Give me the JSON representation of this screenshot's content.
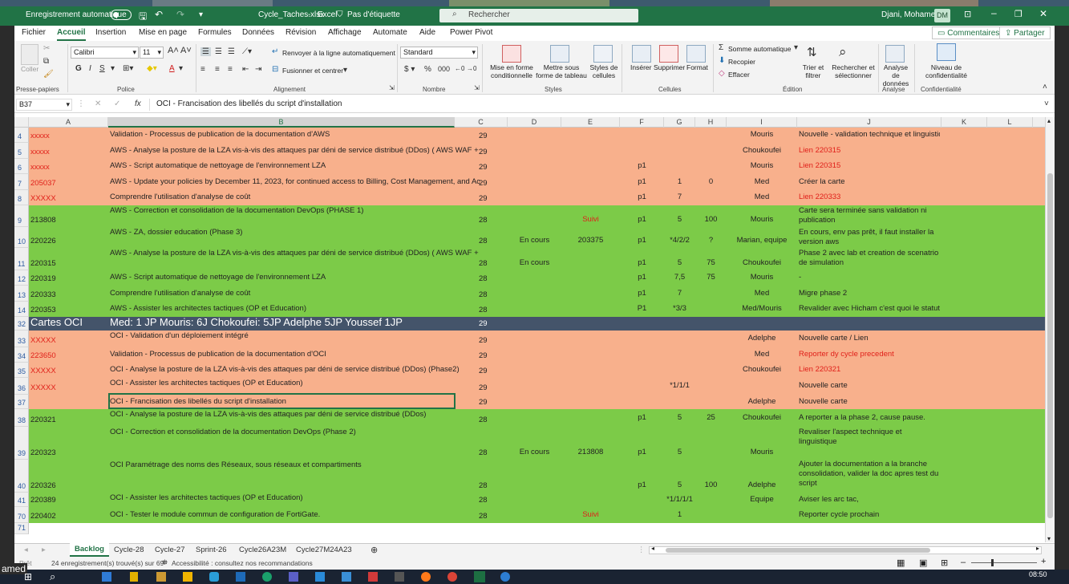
{
  "titlebar": {
    "autosave": "Enregistrement automatique",
    "filename": "Cycle_Taches.xlsx",
    "app": "Excel",
    "label": "Pas d'étiquette",
    "search": "Rechercher",
    "user": "Djani, Mohamed",
    "initials": "DM"
  },
  "menu": {
    "tabs": [
      "Fichier",
      "Accueil",
      "Insertion",
      "Mise en page",
      "Formules",
      "Données",
      "Révision",
      "Affichage",
      "Automate",
      "Aide",
      "Power Pivot"
    ],
    "comments": "Commentaires",
    "share": "Partager"
  },
  "ribbon": {
    "paste": "Coller",
    "font_name": "Calibri",
    "font_size": "11",
    "wrap": "Renvoyer à la ligne automatiquement",
    "merge": "Fusionner et centrer",
    "number_format": "Standard",
    "cond_format": "Mise en forme conditionnelle",
    "format_table": "Mettre sous forme de tableau",
    "cell_styles": "Styles de cellules",
    "insert": "Insérer",
    "delete": "Supprimer",
    "format": "Format",
    "autosum": "Somme automatique",
    "fill": "Recopier",
    "clear": "Effacer",
    "sort": "Trier et filtrer",
    "find": "Rechercher et sélectionner",
    "analyze": "Analyse de données",
    "sensitivity": "Niveau de confidentialité",
    "groups": {
      "clipboard": "Presse-papiers",
      "font": "Police",
      "alignment": "Alignement",
      "number": "Nombre",
      "styles": "Styles",
      "cells": "Cellules",
      "editing": "Édition",
      "analysis": "Analyse",
      "confidentiality": "Confidentialité"
    }
  },
  "formula": {
    "namebox": "B37",
    "content": "OCI - Francisation des libellés du script d'installation"
  },
  "columns": [
    "A",
    "B",
    "C",
    "D",
    "E",
    "F",
    "G",
    "H",
    "I",
    "J",
    "K",
    "L"
  ],
  "rows": [
    {
      "n": "4",
      "A": "xxxxx",
      "B": "Validation - Processus de publication de la documentation d'AWS",
      "C": "29",
      "D": "",
      "E": "",
      "F": "",
      "G": "",
      "H": "",
      "I": "Mouris",
      "J": "Nouvelle - validation technique et linguistique"
    },
    {
      "n": "5",
      "A": "xxxxx",
      "B": "AWS - Analyse la posture de la LZA vis-à-vis des attaques par déni de service distribué (DDos)  ( AWS WAF +",
      "C": "29",
      "D": "",
      "E": "",
      "F": "",
      "G": "",
      "H": "",
      "I": "Choukoufei",
      "J": "Lien 220315"
    },
    {
      "n": "6",
      "A": "xxxxx",
      "B": "AWS - Script automatique de nettoyage de l'environnement LZA",
      "C": "29",
      "D": "",
      "E": "",
      "F": "p1",
      "G": "",
      "H": "",
      "I": "Mouris",
      "J": "Lien 220315"
    },
    {
      "n": "7",
      "A": "205037",
      "B": "AWS - Update your policies by December 11, 2023, for continued access to Billing, Cost Management, and Ac",
      "C": "29",
      "D": "",
      "E": "",
      "F": "p1",
      "G": "1",
      "H": "0",
      "I": "Med",
      "J": "Créer la carte"
    },
    {
      "n": "8",
      "A": "XXXXX",
      "B": "Comprendre l'utilisation d'analyse de coût",
      "C": "29",
      "D": "",
      "E": "",
      "F": "p1",
      "G": "7",
      "H": "",
      "I": "Med",
      "J": "Lien 220333"
    },
    {
      "n": "9",
      "A": "213808",
      "B": "AWS - Correction et consolidation de la documentation DevOps (PHASE 1)",
      "C": "28",
      "D": "",
      "E": "Suivi",
      "F": "p1",
      "G": "5",
      "H": "100",
      "I": "Mouris",
      "J": "Carte sera terminée sans validation ni publication"
    },
    {
      "n": "10",
      "A": "220226",
      "B": "AWS - ZA, dossier education (Phase 3)",
      "C": "28",
      "D": "En cours",
      "E": "203375",
      "F": "p1",
      "G": "*4/2/2",
      "H": "?",
      "I": "Marian, equipe",
      "J": "En cours,  env pas prêt, il faut installer la version aws"
    },
    {
      "n": "11",
      "A": "220315",
      "B": "AWS - Analyse la posture de la LZA vis-à-vis des attaques par déni de service distribué (DDos)  ( AWS WAF +",
      "C": "28",
      "D": "En cours",
      "E": "",
      "F": "p1",
      "G": "5",
      "H": "75",
      "I": "Choukoufei",
      "J": "Phase 2 avec lab et creation de scenatrio de simulation"
    },
    {
      "n": "12",
      "A": "220319",
      "B": "AWS - Script automatique de nettoyage de l'environnement LZA",
      "C": "28",
      "D": "",
      "E": "",
      "F": "p1",
      "G": "7,5",
      "H": "75",
      "I": "Mouris",
      "J": "-"
    },
    {
      "n": "13",
      "A": "220333",
      "B": "Comprendre l'utilisation d'analyse de coût",
      "C": "28",
      "D": "",
      "E": "",
      "F": "p1",
      "G": "7",
      "H": "",
      "I": "Med",
      "J": "Migre phase 2"
    },
    {
      "n": "14",
      "A": "220353",
      "B": "AWS - Assister les architectes tactiques (OP et Education)",
      "C": "28",
      "D": "",
      "E": "",
      "F": "P1",
      "G": "*3/3",
      "H": "",
      "I": "Med/Mouris",
      "J": "Revalider avec Hicham c'est quoi le statut"
    },
    {
      "n": "32",
      "A": "Cartes OCI",
      "B": "Med:  1 JP  Mouris: 6J  Chokoufei: 5JP Adelphe  5JP Youssef 1JP",
      "C": "29",
      "D": "",
      "E": "",
      "F": "",
      "G": "",
      "H": "",
      "I": "",
      "J": ""
    },
    {
      "n": "33",
      "A": "XXXXX",
      "B": "OCI - Validation d'un déploiement intégré",
      "C": "29",
      "D": "",
      "E": "",
      "F": "",
      "G": "",
      "H": "",
      "I": "Adelphe",
      "J": "Nouvelle carte / Lien"
    },
    {
      "n": "34",
      "A": "223650",
      "B": "Validation - Processus de publication de la documentation d'OCI",
      "C": "29",
      "D": "",
      "E": "",
      "F": "",
      "G": "",
      "H": "",
      "I": "Med",
      "J": "Reporter dy cycle precedent"
    },
    {
      "n": "35",
      "A": "XXXXX",
      "B": "OCI - Analyse la posture de la LZA vis-à-vis des attaques par déni de service distribué (DDos)  (Phase2)",
      "C": "29",
      "D": "",
      "E": "",
      "F": "",
      "G": "",
      "H": "",
      "I": "Choukoufei",
      "J": "Lien 220321"
    },
    {
      "n": "36",
      "A": "XXXXX",
      "B": "OCI  - Assister les architectes tactiques (OP et Education)",
      "C": "29",
      "D": "",
      "E": "",
      "F": "",
      "G": "*1/1/1",
      "H": "",
      "I": "",
      "J": "Nouvelle carte"
    },
    {
      "n": "37",
      "A": "",
      "B": "OCI - Francisation des libellés du script d'installation",
      "C": "29",
      "D": "",
      "E": "",
      "F": "",
      "G": "",
      "H": "",
      "I": "Adelphe",
      "J": "Nouvelle carte"
    },
    {
      "n": "38",
      "A": "220321",
      "B": "OCI - Analyse la posture de la LZA vis-à-vis des attaques par déni de service distribué (DDos)",
      "C": "28",
      "D": "",
      "E": "",
      "F": "p1",
      "G": "5",
      "H": "25",
      "I": "Choukoufei",
      "J": "A reporter a la phase 2, cause pause."
    },
    {
      "n": "39",
      "A": "220323",
      "B": "OCI - Correction et consolidation de la documentation DevOps  (Phase 2)",
      "C": "28",
      "D": "En cours",
      "E": "213808",
      "F": "p1",
      "G": "5",
      "H": "",
      "I": "Mouris",
      "J": "Revaliser l'aspect technique et linguistique"
    },
    {
      "n": "40",
      "A": "220326",
      "B": "OCI Paramétrage des noms des Réseaux, sous réseaux et compartiments",
      "C": "28",
      "D": "",
      "E": "",
      "F": "p1",
      "G": "5",
      "H": "100",
      "I": "Adelphe",
      "J": "Ajouter la documentation a la branche consolidation, valider la doc apres test du script"
    },
    {
      "n": "41",
      "A": "220389",
      "B": "OCI  - Assister les architectes tactiques (OP et Education)",
      "C": "28",
      "D": "",
      "E": "",
      "F": "",
      "G": "*1/1/1/1",
      "H": "",
      "I": "Equipe",
      "J": "Aviser les arc tac,"
    },
    {
      "n": "70",
      "A": "220402",
      "B": "OCI - Tester le module commun de configuration  de FortiGate.",
      "C": "28",
      "D": "",
      "E": "Suivi",
      "F": "",
      "G": "1",
      "H": "",
      "I": "",
      "J": "Reporter cycle prochain"
    },
    {
      "n": "71",
      "A": "",
      "B": "",
      "C": "",
      "D": "",
      "E": "",
      "F": "",
      "G": "",
      "H": "",
      "I": "",
      "J": ""
    }
  ],
  "sheet_tabs": [
    "Backlog",
    "Cycle-28",
    "Cycle-27",
    "Sprint-26",
    "Cycle26A23M",
    "Cycle27M24A23"
  ],
  "status": {
    "mode": "Prêt",
    "records": "24 enregistrement(s) trouvé(s) sur 69",
    "accessibility": "Accessibilité : consultez nos recommandations"
  },
  "taskbar": {
    "time": "08:50",
    "left_label": "amed"
  }
}
